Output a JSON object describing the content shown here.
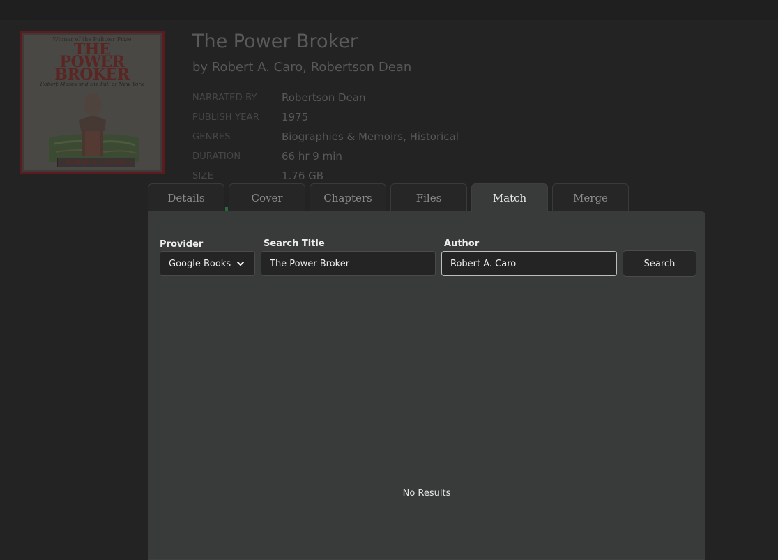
{
  "book": {
    "title": "The Power Broker",
    "byline": "by Robert A. Caro, Robertson Dean",
    "cover": {
      "pulitzer": "Winner of the Pulitzer Prize",
      "title_line1": "THE",
      "title_line2": "POWER",
      "title_line3": "BROKER",
      "subtitle": "Robert Moses and the Fall of New York",
      "author": "by ROBERT A. CARO"
    },
    "meta": [
      {
        "label": "NARRATED BY",
        "value": "Robertson Dean"
      },
      {
        "label": "PUBLISH YEAR",
        "value": "1975"
      },
      {
        "label": "GENRES",
        "value": "Biographies & Memoirs, Historical"
      },
      {
        "label": "DURATION",
        "value": "66 hr 9 min"
      },
      {
        "label": "SIZE",
        "value": "1.76 GB"
      }
    ]
  },
  "tabs": [
    {
      "label": "Details"
    },
    {
      "label": "Cover"
    },
    {
      "label": "Chapters"
    },
    {
      "label": "Files"
    },
    {
      "label": "Match",
      "active": true
    },
    {
      "label": "Merge"
    }
  ],
  "match": {
    "provider_label": "Provider",
    "provider_value": "Google Books",
    "title_label": "Search Title",
    "title_value": "The Power Broker",
    "author_label": "Author",
    "author_value": "Robert A. Caro",
    "search_button": "Search",
    "no_results": "No Results"
  },
  "colors": {
    "background": "#232323",
    "panel": "#393b3a",
    "input_bg": "#242424",
    "cover_border": "#5a1c1e"
  }
}
